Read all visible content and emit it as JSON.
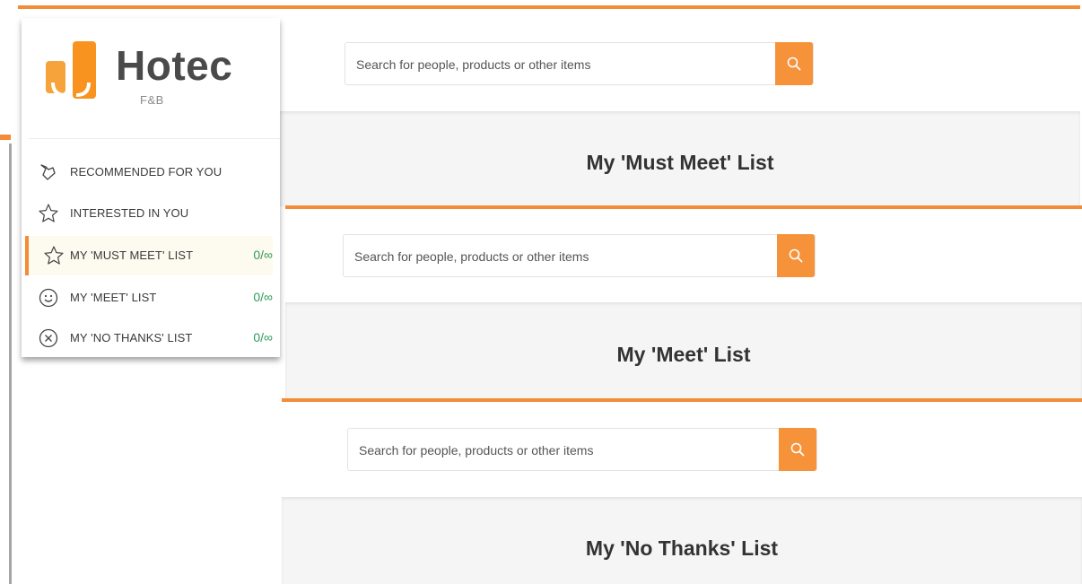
{
  "brand": {
    "name": "Hotec",
    "sub": "F&B"
  },
  "sidebar": {
    "items": [
      {
        "label": "RECOMMENDED FOR YOU",
        "icon": "handshake-icon",
        "count": ""
      },
      {
        "label": "INTERESTED IN YOU",
        "icon": "star-icon",
        "count": ""
      },
      {
        "label": "MY 'MUST MEET' LIST",
        "icon": "star-icon",
        "count": "0/∞",
        "active": true
      },
      {
        "label": "MY 'MEET' LIST",
        "icon": "smiley-icon",
        "count": "0/∞"
      },
      {
        "label": "MY 'NO THANKS' LIST",
        "icon": "close-circle-icon",
        "count": "0/∞"
      }
    ]
  },
  "panels": [
    {
      "search_placeholder": "Search for people, products or other items",
      "title": "My 'Must Meet' List"
    },
    {
      "search_placeholder": "Search for people, products or other items",
      "title": "My 'Meet' List"
    },
    {
      "search_placeholder": "Search for people, products or other items",
      "title": "My 'No Thanks' List"
    }
  ],
  "colors": {
    "accent": "#f28c38",
    "count_green": "#2e9a5a",
    "title_bar": "#f5f5f5"
  }
}
